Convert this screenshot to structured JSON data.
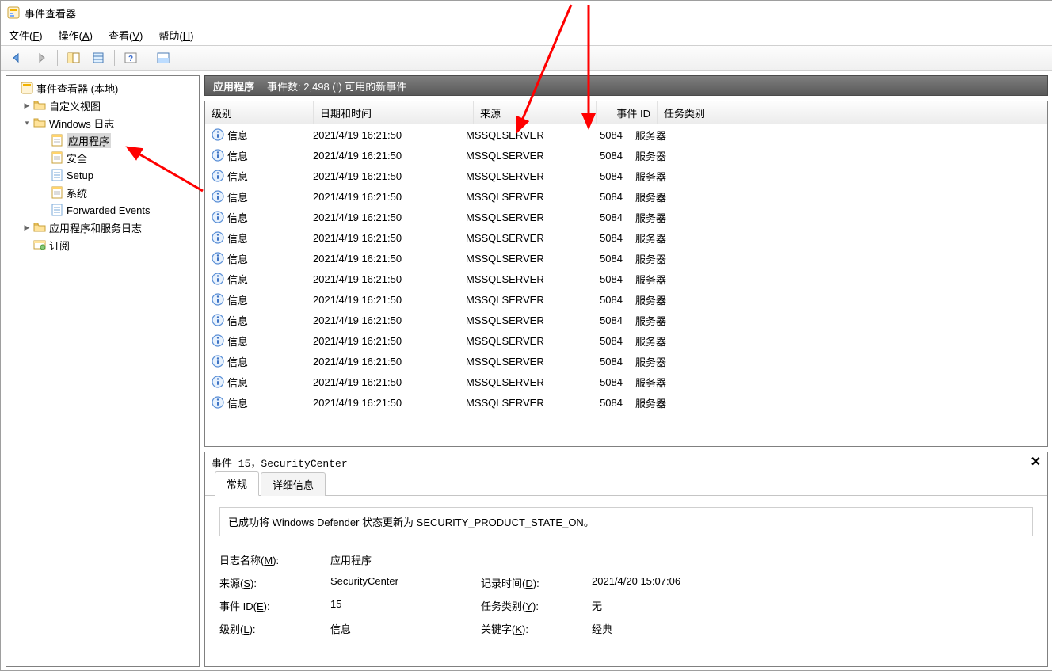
{
  "title": "事件查看器",
  "menubar": [
    {
      "label": "文件(F)",
      "ul": "F"
    },
    {
      "label": "操作(A)",
      "ul": "A"
    },
    {
      "label": "查看(V)",
      "ul": "V"
    },
    {
      "label": "帮助(H)",
      "ul": "H"
    }
  ],
  "sidebar": {
    "root": "事件查看器 (本地)",
    "items": [
      {
        "label": "自定义视图",
        "indent": 1,
        "exp": ">",
        "icon": "folder"
      },
      {
        "label": "Windows 日志",
        "indent": 1,
        "exp": "v",
        "icon": "folder"
      },
      {
        "label": "应用程序",
        "indent": 2,
        "icon": "log",
        "selected": true
      },
      {
        "label": "安全",
        "indent": 2,
        "icon": "log"
      },
      {
        "label": "Setup",
        "indent": 2,
        "icon": "log2"
      },
      {
        "label": "系统",
        "indent": 2,
        "icon": "log"
      },
      {
        "label": "Forwarded Events",
        "indent": 2,
        "icon": "log2"
      },
      {
        "label": "应用程序和服务日志",
        "indent": 1,
        "exp": ">",
        "icon": "folder"
      },
      {
        "label": "订阅",
        "indent": 1,
        "icon": "sub"
      }
    ]
  },
  "list_header": {
    "name": "应用程序",
    "count_text": "事件数: 2,498 (!) 可用的新事件"
  },
  "columns": {
    "level": "级别",
    "date": "日期和时间",
    "source": "来源",
    "eid": "事件 ID",
    "cat": "任务类别"
  },
  "rows": [
    {
      "level": "信息",
      "date": "2021/4/19 16:21:50",
      "src": "MSSQLSERVER",
      "eid": "5084",
      "cat": "服务器"
    },
    {
      "level": "信息",
      "date": "2021/4/19 16:21:50",
      "src": "MSSQLSERVER",
      "eid": "5084",
      "cat": "服务器"
    },
    {
      "level": "信息",
      "date": "2021/4/19 16:21:50",
      "src": "MSSQLSERVER",
      "eid": "5084",
      "cat": "服务器"
    },
    {
      "level": "信息",
      "date": "2021/4/19 16:21:50",
      "src": "MSSQLSERVER",
      "eid": "5084",
      "cat": "服务器"
    },
    {
      "level": "信息",
      "date": "2021/4/19 16:21:50",
      "src": "MSSQLSERVER",
      "eid": "5084",
      "cat": "服务器"
    },
    {
      "level": "信息",
      "date": "2021/4/19 16:21:50",
      "src": "MSSQLSERVER",
      "eid": "5084",
      "cat": "服务器"
    },
    {
      "level": "信息",
      "date": "2021/4/19 16:21:50",
      "src": "MSSQLSERVER",
      "eid": "5084",
      "cat": "服务器"
    },
    {
      "level": "信息",
      "date": "2021/4/19 16:21:50",
      "src": "MSSQLSERVER",
      "eid": "5084",
      "cat": "服务器"
    },
    {
      "level": "信息",
      "date": "2021/4/19 16:21:50",
      "src": "MSSQLSERVER",
      "eid": "5084",
      "cat": "服务器"
    },
    {
      "level": "信息",
      "date": "2021/4/19 16:21:50",
      "src": "MSSQLSERVER",
      "eid": "5084",
      "cat": "服务器"
    },
    {
      "level": "信息",
      "date": "2021/4/19 16:21:50",
      "src": "MSSQLSERVER",
      "eid": "5084",
      "cat": "服务器"
    },
    {
      "level": "信息",
      "date": "2021/4/19 16:21:50",
      "src": "MSSQLSERVER",
      "eid": "5084",
      "cat": "服务器"
    },
    {
      "level": "信息",
      "date": "2021/4/19 16:21:50",
      "src": "MSSQLSERVER",
      "eid": "5084",
      "cat": "服务器"
    },
    {
      "level": "信息",
      "date": "2021/4/19 16:21:50",
      "src": "MSSQLSERVER",
      "eid": "5084",
      "cat": "服务器"
    }
  ],
  "detail": {
    "title": "事件 15，SecurityCenter",
    "tabs": {
      "general": "常规",
      "details": "详细信息"
    },
    "message": "已成功将 Windows Defender 状态更新为 SECURITY_PRODUCT_STATE_ON。",
    "fields": {
      "log_name_k": "日志名称(M):",
      "log_name_v": "应用程序",
      "source_k": "来源(S):",
      "source_v": "SecurityCenter",
      "logged_k": "记录时间(D):",
      "logged_v": "2021/4/20 15:07:06",
      "eid_k": "事件 ID(E):",
      "eid_v": "15",
      "cat_k": "任务类别(Y):",
      "cat_v": "无",
      "level_k": "级别(L):",
      "level_v": "信息",
      "kw_k": "关键字(K):",
      "kw_v": "经典"
    }
  }
}
